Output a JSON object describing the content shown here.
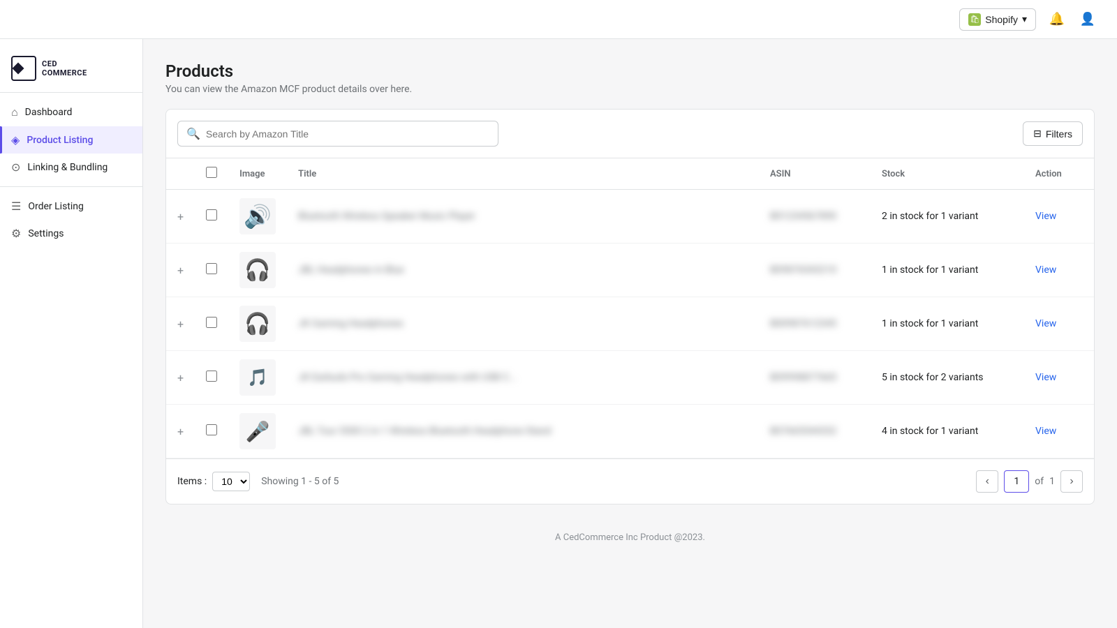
{
  "topbar": {
    "shopify_label": "Shopify",
    "bell_icon": "🔔",
    "user_icon": "👤"
  },
  "logo": {
    "line1": "CED",
    "line2": "COMMERCE"
  },
  "sidebar": {
    "items": [
      {
        "id": "dashboard",
        "label": "Dashboard",
        "icon": "⌂",
        "active": false
      },
      {
        "id": "product-listing",
        "label": "Product Listing",
        "icon": "◈",
        "active": true
      },
      {
        "id": "linking-bundling",
        "label": "Linking & Bundling",
        "icon": "⊙",
        "active": false
      },
      {
        "id": "order-listing",
        "label": "Order Listing",
        "icon": "☰",
        "active": false
      },
      {
        "id": "settings",
        "label": "Settings",
        "icon": "⚙",
        "active": false
      }
    ]
  },
  "page": {
    "title": "Products",
    "subtitle": "You can view the Amazon MCF product details over here.",
    "search_placeholder": "Search by Amazon Title",
    "filter_label": "Filters"
  },
  "table": {
    "columns": [
      "Image",
      "Title",
      "ASIN",
      "Stock",
      "Action"
    ],
    "rows": [
      {
        "id": 1,
        "icon": "🔊",
        "icon_class": "prod-icon-1",
        "title_blurred": "Bluetooth Wireless Speaker Music Player",
        "asin_blurred": "B01234567890",
        "stock": "2 in stock for 1 variant",
        "action": "View"
      },
      {
        "id": 2,
        "icon": "🎧",
        "icon_class": "prod-icon-2",
        "title_blurred": "JBL Headphones in Blue",
        "asin_blurred": "B09876543210",
        "stock": "1 in stock for 1 variant",
        "action": "View"
      },
      {
        "id": 3,
        "icon": "🎧",
        "icon_class": "prod-icon-3",
        "title_blurred": "JK Gaming Headphones",
        "asin_blurred": "B00987612345",
        "stock": "1 in stock for 1 variant",
        "action": "View"
      },
      {
        "id": 4,
        "icon": "🎵",
        "icon_class": "prod-icon-4",
        "title_blurred": "JK Earbuds Pro Gaming Headphones with USB C...",
        "asin_blurred": "B09998877665",
        "stock": "5 in stock for 2 variants",
        "action": "View"
      },
      {
        "id": 5,
        "icon": "🎤",
        "icon_class": "prod-icon-5",
        "title_blurred": "JBL Tour 5500 2 in 1 Wireless Bluetooth Headphone Stand",
        "asin_blurred": "B07665544332",
        "stock": "4 in stock for 1 variant",
        "action": "View"
      }
    ]
  },
  "pagination": {
    "items_label": "Items :",
    "items_value": "10",
    "showing_text": "Showing 1 - 5 of 5",
    "current_page": "1",
    "total_pages": "1",
    "of_label": "of"
  },
  "footer": {
    "text": "A CedCommerce Inc Product @2023."
  }
}
